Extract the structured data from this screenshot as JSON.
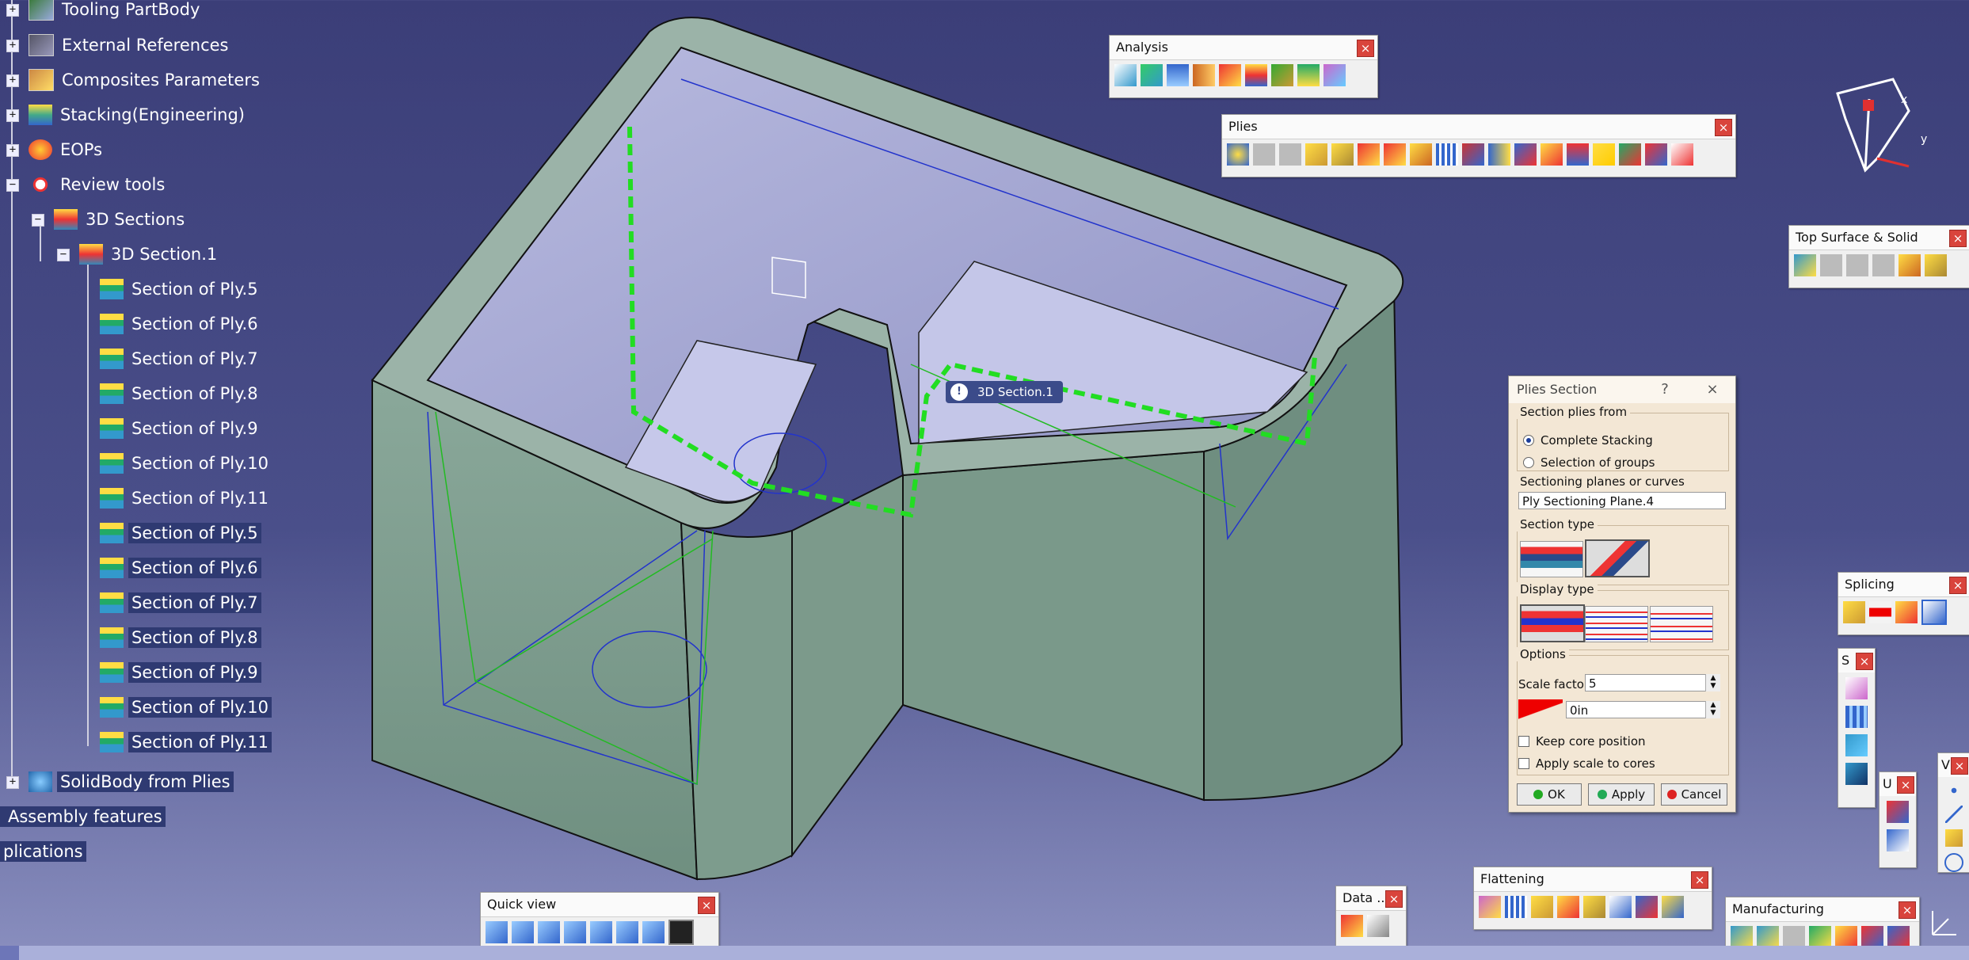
{
  "tree": {
    "items": [
      {
        "label": "Tooling PartBody"
      },
      {
        "label": "External References"
      },
      {
        "label": "Composites Parameters"
      },
      {
        "label": "Stacking(Engineering)"
      },
      {
        "label": "EOPs"
      },
      {
        "label": "Review tools"
      },
      {
        "label": "3D Sections"
      },
      {
        "label": "3D Section.1"
      },
      {
        "label": "Section of Ply.5"
      },
      {
        "label": "Section of Ply.6"
      },
      {
        "label": "Section of Ply.7"
      },
      {
        "label": "Section of Ply.8"
      },
      {
        "label": "Section of Ply.9"
      },
      {
        "label": "Section of Ply.10"
      },
      {
        "label": "Section of Ply.11"
      },
      {
        "label": "Section of Ply.5"
      },
      {
        "label": "Section of Ply.6"
      },
      {
        "label": "Section of Ply.7"
      },
      {
        "label": "Section of Ply.8"
      },
      {
        "label": "Section of Ply.9"
      },
      {
        "label": "Section of Ply.10"
      },
      {
        "label": "Section of Ply.11"
      },
      {
        "label": "SolidBody from Plies"
      },
      {
        "label": "Assembly features"
      },
      {
        "label": "plications"
      }
    ]
  },
  "toolbars": {
    "analysis": {
      "title": "Analysis",
      "close": "×"
    },
    "plies": {
      "title": "Plies",
      "close": "×"
    },
    "top_surface": {
      "title": "Top Surface & Solid",
      "close": "×"
    },
    "splicing": {
      "title": "Splicing",
      "close": "×"
    },
    "s_small": {
      "title": "S",
      "close": "×"
    },
    "u_small": {
      "title": "U",
      "close": "×"
    },
    "v_small": {
      "title": "V",
      "close": "×"
    },
    "quick_view": {
      "title": "Quick view",
      "close": "×"
    },
    "data": {
      "title": "Data ...",
      "close": "×"
    },
    "flattening": {
      "title": "Flattening",
      "close": "×"
    },
    "manufacturing": {
      "title": "Manufacturing",
      "close": "×"
    }
  },
  "tooltip": {
    "label": "3D Section.1"
  },
  "compass": {
    "x_label": "x",
    "y_label": "y"
  },
  "dialog": {
    "title": "Plies Section",
    "help": "?",
    "close": "×",
    "section_plies_from": "Section plies from",
    "opt_complete": "Complete Stacking",
    "opt_groups": "Selection of groups",
    "sectioning_label": "Sectioning planes or curves",
    "sectioning_value": "Ply Sectioning Plane.4",
    "section_type_label": "Section type",
    "display_type_label": "Display type",
    "options_label": "Options",
    "scale_factor_label": "Scale factor",
    "scale_factor_value": "5",
    "offset_value": "0in",
    "keep_core": "Keep core position",
    "apply_scale": "Apply scale to cores",
    "ok": "OK",
    "apply": "Apply",
    "cancel": "Cancel"
  }
}
